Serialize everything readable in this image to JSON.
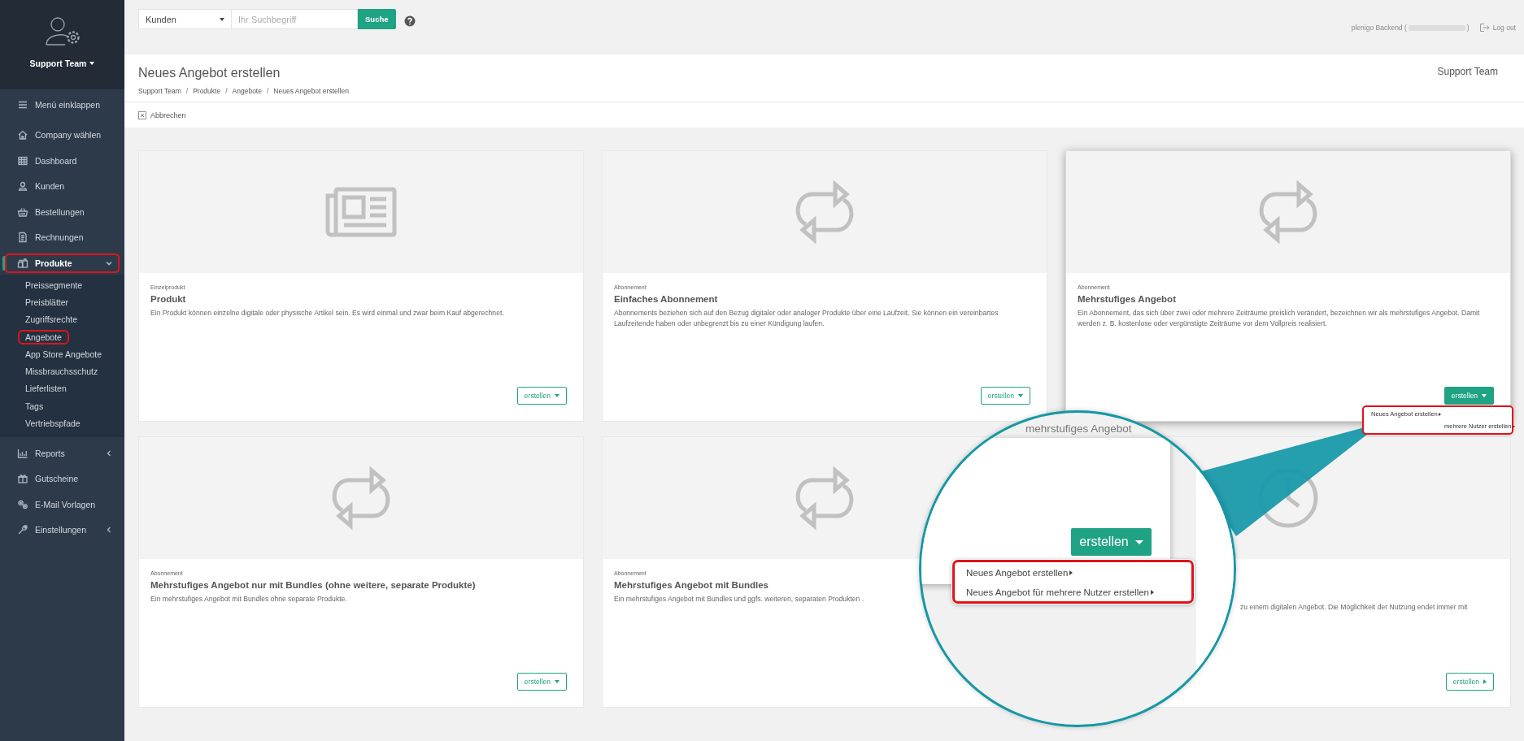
{
  "sidebar": {
    "team": "Support Team",
    "collapse": "Menü einklappen",
    "items": [
      {
        "label": "Company wählen",
        "kind": "home",
        "selected": false,
        "highlighted": false,
        "expandable": false
      },
      {
        "label": "Dashboard",
        "kind": "grid",
        "selected": false,
        "highlighted": false,
        "expandable": false
      },
      {
        "label": "Kunden",
        "kind": "user",
        "selected": false,
        "highlighted": false,
        "expandable": false
      },
      {
        "label": "Bestellungen",
        "kind": "basket",
        "selected": false,
        "highlighted": false,
        "expandable": false
      },
      {
        "label": "Rechnungen",
        "kind": "doc",
        "selected": false,
        "highlighted": false,
        "expandable": false
      },
      {
        "label": "Produkte",
        "kind": "products",
        "selected": true,
        "highlighted": true,
        "expandable": true,
        "expanded": true,
        "children": [
          {
            "label": "Preissegmente",
            "highlighted": false
          },
          {
            "label": "Preisblätter",
            "highlighted": false
          },
          {
            "label": "Zugriffsrechte",
            "highlighted": false
          },
          {
            "label": "Angebote",
            "highlighted": true
          },
          {
            "label": "App Store Angebote",
            "highlighted": false
          },
          {
            "label": "Missbrauchsschutz",
            "highlighted": false
          },
          {
            "label": "Lieferlisten",
            "highlighted": false
          },
          {
            "label": "Tags",
            "highlighted": false
          },
          {
            "label": "Vertriebspfade",
            "highlighted": false
          }
        ]
      },
      {
        "label": "Reports",
        "kind": "chart",
        "selected": false,
        "highlighted": false,
        "expandable": true,
        "expanded": false
      },
      {
        "label": "Gutscheine",
        "kind": "gift",
        "selected": false,
        "highlighted": false,
        "expandable": false
      },
      {
        "label": "E-Mail Vorlagen",
        "kind": "mail",
        "selected": false,
        "highlighted": false,
        "expandable": false
      },
      {
        "label": "Einstellungen",
        "kind": "wrench",
        "selected": false,
        "highlighted": false,
        "expandable": true,
        "expanded": false
      }
    ]
  },
  "topbar": {
    "search_scope": "Kunden",
    "search": {
      "placeholder": "Ihr Suchbegriff"
    },
    "search_button": "Suche",
    "user_prefix": "plenigo Backend (",
    "user_suffix": ")",
    "logout": "Log out"
  },
  "header": {
    "title": "Neues Angebot erstellen",
    "company": "Support Team",
    "breadcrumb": [
      {
        "label": "Support Team"
      },
      {
        "separator": "/",
        "label": "Produkte"
      },
      {
        "separator": "/",
        "label": "Angebote"
      },
      {
        "separator": "/",
        "label": "Neues Angebot erstellen"
      }
    ],
    "cancel": "Abbrechen"
  },
  "cards": [
    {
      "kind": "single",
      "covered": false,
      "raised": false,
      "label": "Einzelprodukt",
      "title": "Produkt",
      "description": "Ein Produkt können einzelne digitale oder physische Artikel sein. Es wird einmal und zwar beim Kauf abgerechnet.",
      "button": {
        "label": "erstellen",
        "kind": "dropdown"
      }
    },
    {
      "kind": "subscription",
      "covered": false,
      "raised": false,
      "label": "Abonnement",
      "title": "Einfaches Abonnement",
      "description": "Abonnements beziehen sich auf den Bezug digitaler oder analoger Produkte über eine Laufzeit. Sie können ein vereinbartes Laufzeitende haben oder unbegrenzt bis zu einer Kündigung laufen.",
      "button": {
        "label": "erstellen",
        "kind": "dropdown"
      }
    },
    {
      "kind": "subscription",
      "covered": false,
      "raised": true,
      "label": "Abonnement",
      "title": "Mehrstufiges Angebot",
      "description": "Ein Abonnement, das sich über zwei oder mehrere Zeiträume preislich verändert, bezeichnen wir als mehrstufiges Angebot. Damit werden z. B. kostenlose oder vergünstigte Zeiträume vor dem Vollpreis realisiert.",
      "button": {
        "label": "erstellen",
        "kind": "dropdown",
        "expanded": true
      },
      "menu": {
        "highlighted": true,
        "items": [
          "Neues Angebot erstellen",
          "mehrere Nutzer erstellen"
        ]
      }
    },
    {
      "kind": "subscription",
      "covered": false,
      "raised": false,
      "label": "Abonnement",
      "title": "Mehrstufiges Angebot nur mit Bundles (ohne weitere, separate Produkte)",
      "description": "Ein mehrstufiges Angebot mit Bundles ohne separate Produkte.",
      "button": {
        "label": "erstellen",
        "kind": "dropdown"
      }
    },
    {
      "kind": "subscription",
      "covered": false,
      "raised": false,
      "label": "Abonnement",
      "title": "Mehrstufiges Angebot mit Bundles",
      "description": "Ein mehrstufiges Angebot mit Bundles und ggfs. weiteren, separaten Produkten ."
    },
    {
      "kind": "timed",
      "covered": true,
      "raised": false,
      "description": "zu einem digitalen Angebot. Die Möglichkeit der Nutzung endet immer mit",
      "button": {
        "label": "erstellen",
        "kind": "link"
      }
    }
  ],
  "magnifier": {
    "caption": "mehrstufiges Angebot",
    "button": "erstellen",
    "menu": {
      "highlighted": true,
      "items": [
        "Neues Angebot erstellen",
        "Neues Angebot für mehrere Nutzer erstellen"
      ]
    }
  }
}
